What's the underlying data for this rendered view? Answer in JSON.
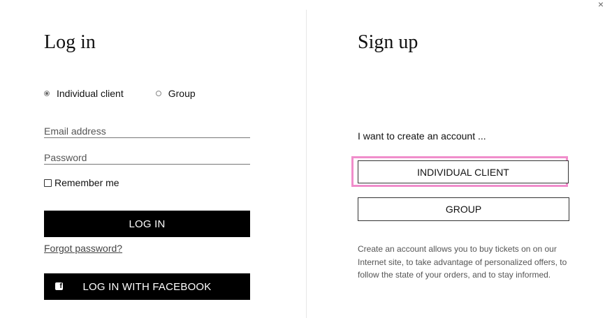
{
  "close_icon": "×",
  "login": {
    "title": "Log in",
    "client_types": [
      {
        "label": "Individual client",
        "selected": true
      },
      {
        "label": "Group",
        "selected": false
      }
    ],
    "email_placeholder": "Email address",
    "password_placeholder": "Password",
    "remember_label": "Remember me",
    "remember_checked": false,
    "login_button": "LOG IN",
    "forgot_link": "Forgot password?",
    "facebook_icon": "f",
    "facebook_button": "LOG IN WITH FACEBOOK"
  },
  "signup": {
    "title": "Sign up",
    "prompt": "I want to create an account ...",
    "individual_button": "INDIVIDUAL CLIENT",
    "group_button": "GROUP",
    "description": "Create an account allows you to buy tickets on on our Internet site, to take advantage of personalized offers, to follow the state of your orders, and to stay informed."
  },
  "colors": {
    "highlight": "#f08dcb",
    "button_bg": "#000000",
    "divider": "#e6e6e6"
  }
}
